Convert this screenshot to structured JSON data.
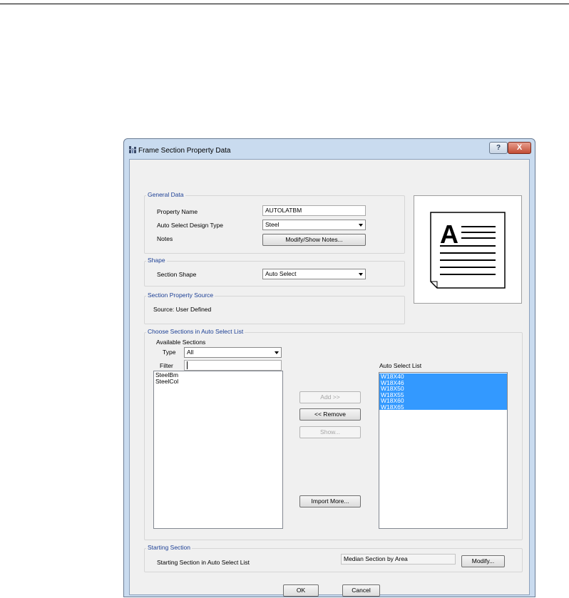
{
  "window": {
    "title": "Frame Section Property Data",
    "help_label": "?",
    "close_label": "X"
  },
  "general_data": {
    "label": "General Data",
    "property_name_label": "Property Name",
    "property_name_value": "AUTOLATBM",
    "design_type_label": "Auto Select Design Type",
    "design_type_value": "Steel",
    "notes_label": "Notes",
    "notes_button": "Modify/Show Notes..."
  },
  "shape": {
    "label": "Shape",
    "section_shape_label": "Section Shape",
    "section_shape_value": "Auto Select"
  },
  "property_source": {
    "label": "Section Property Source",
    "source_text": "Source:  User Defined"
  },
  "choose_sections": {
    "label": "Choose Sections in Auto Select List",
    "available_label": "Available Sections",
    "type_label": "Type",
    "type_value": "All",
    "filter_label": "Filter",
    "filter_value": "",
    "available_items": [
      "SteelBm",
      "SteelCol"
    ],
    "auto_select_label": "Auto Select List",
    "auto_select_items": [
      "W18X40",
      "W18X46",
      "W18X50",
      "W18X55",
      "W18X60",
      "W18X65"
    ],
    "add_button": "Add >>",
    "remove_button": "<< Remove",
    "show_button": "Show...",
    "import_button": "Import More..."
  },
  "starting_section": {
    "label": "Starting Section",
    "row_label": "Starting Section in Auto Select List",
    "value": "Median Section by Area",
    "modify_button": "Modify..."
  },
  "footer": {
    "ok_button": "OK",
    "cancel_button": "Cancel"
  },
  "icons": {
    "app": "frame-app-icon",
    "preview": "text-document-icon"
  },
  "colors": {
    "group_label": "#1c3f95",
    "selection": "#3399ff",
    "close_button": "#c24d35"
  }
}
